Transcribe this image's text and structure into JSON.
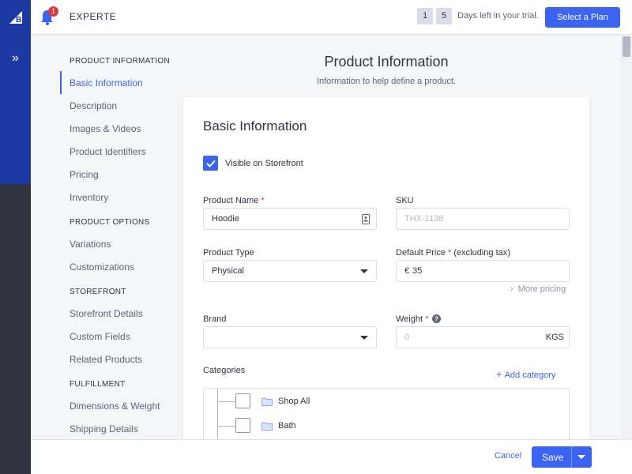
{
  "header": {
    "store_name": "EXPERTE",
    "notification_count": "1",
    "trial_days": [
      "1",
      "5"
    ],
    "trial_text": "Days left in your trial.",
    "plan_button": "Select a Plan"
  },
  "nav": {
    "sections": [
      {
        "title": "PRODUCT INFORMATION",
        "items": [
          "Basic Information",
          "Description",
          "Images & Videos",
          "Product Identifiers",
          "Pricing",
          "Inventory"
        ]
      },
      {
        "title": "PRODUCT OPTIONS",
        "items": [
          "Variations",
          "Customizations"
        ]
      },
      {
        "title": "STOREFRONT",
        "items": [
          "Storefront Details",
          "Custom Fields",
          "Related Products"
        ]
      },
      {
        "title": "FULFILLMENT",
        "items": [
          "Dimensions & Weight",
          "Shipping Details"
        ]
      }
    ],
    "active": "Basic Information"
  },
  "page": {
    "title": "Product Information",
    "subtitle": "Information to help define a product."
  },
  "form": {
    "section_title": "Basic Information",
    "visible_label": "Visible on Storefront",
    "visible_checked": true,
    "product_name_label": "Product Name",
    "product_name_value": "Hoodie",
    "sku_label": "SKU",
    "sku_placeholder": "THX-1138",
    "product_type_label": "Product Type",
    "product_type_value": "Physical",
    "price_label": "Default Price",
    "price_suffix": "(excluding tax)",
    "price_currency": "€",
    "price_value": "35",
    "more_pricing": "More pricing",
    "brand_label": "Brand",
    "brand_value": "",
    "weight_label": "Weight",
    "weight_placeholder": "0",
    "weight_unit": "KGS",
    "categories_label": "Categories",
    "add_category": "Add category",
    "categories": [
      "Shop All",
      "Bath"
    ],
    "required_mark": "*"
  },
  "footer": {
    "cancel": "Cancel",
    "save": "Save"
  },
  "colors": {
    "accent": "#3c64f4",
    "rail_blue": "#1d39a2",
    "rail_dark": "#313440",
    "required": "#db3643"
  }
}
